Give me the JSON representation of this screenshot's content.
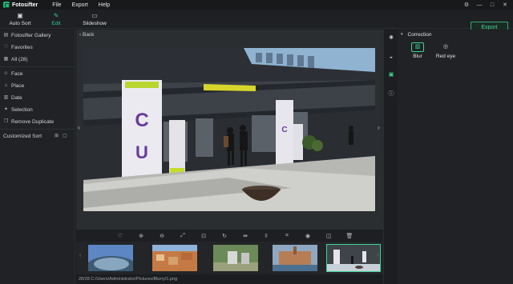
{
  "app": {
    "name": "Fotosifter"
  },
  "menu": [
    "File",
    "Export",
    "Help"
  ],
  "window_controls": {
    "settings_icon": "gear-icon",
    "minimize": "—",
    "maximize": "□",
    "close": "✕"
  },
  "toolbar": {
    "tools": [
      {
        "label": "Auto Sort",
        "icon": "auto-sort-icon",
        "active": false
      },
      {
        "label": "Edit",
        "icon": "edit-icon",
        "active": true
      },
      {
        "label": "Slideshow",
        "icon": "slideshow-icon",
        "active": false
      }
    ],
    "export_label": "Export"
  },
  "sidebar": {
    "items": [
      {
        "label": "Fotosifter Gallery",
        "icon": "gallery-icon"
      },
      {
        "label": "Favorites",
        "icon": "favorites-icon"
      },
      {
        "label": "All (28)",
        "icon": "all-icon"
      },
      {
        "label": "Face",
        "icon": "face-icon"
      },
      {
        "label": "Place",
        "icon": "place-icon"
      },
      {
        "label": "Date",
        "icon": "date-icon"
      },
      {
        "label": "Selection",
        "icon": "selection-icon"
      },
      {
        "label": "Remove Duplicate",
        "icon": "duplicate-icon"
      }
    ],
    "custom_sort_label": "Customized Sort"
  },
  "viewer": {
    "back_label": "Back"
  },
  "status": {
    "text": "28/28  C:/Users/Administrator/Pictures/Blurry/1.png"
  },
  "right_panel": {
    "section_title": "Correction",
    "effects": [
      {
        "label": "Blur",
        "icon": "blur-icon",
        "active": true
      },
      {
        "label": "Red eye",
        "icon": "red-eye-icon",
        "active": false
      }
    ]
  },
  "colors": {
    "accent": "#33c98a",
    "background": "#1b1d20",
    "panel": "#202225"
  }
}
